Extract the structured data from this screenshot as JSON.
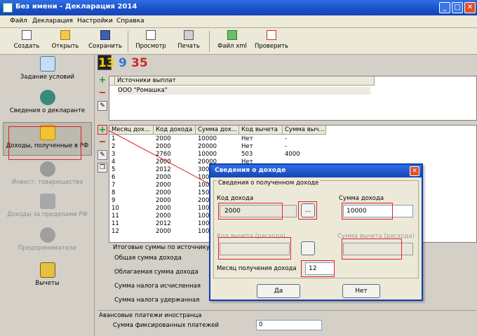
{
  "window": {
    "title": "Без имени - Декларация 2014"
  },
  "menu": [
    "Файл",
    "Декларация",
    "Настройки",
    "Справка"
  ],
  "toolbar": {
    "create": "Создать",
    "open": "Открыть",
    "save": "Сохранить",
    "preview": "Просмотр",
    "print": "Печать",
    "xml": "Файл xml",
    "check": "Проверить"
  },
  "leftnav": [
    {
      "label": "Задание условий",
      "enabled": true
    },
    {
      "label": "Сведения о декларанте",
      "enabled": true
    },
    {
      "label": "Доходы, полученные в РФ",
      "enabled": true,
      "selected": true
    },
    {
      "label": "Инвест. товарищества",
      "enabled": false
    },
    {
      "label": "Доходы за пределами РФ",
      "enabled": false
    },
    {
      "label": "Предприниматели",
      "enabled": false
    },
    {
      "label": "Вычеты",
      "enabled": true
    }
  ],
  "rate_tabs": [
    "13",
    "9",
    "35"
  ],
  "sources": {
    "header": "Источники выплат",
    "rows": [
      "ООО \"Ромашка\""
    ]
  },
  "income_table": {
    "headers": [
      "Месяц дох...",
      "Код дохода",
      "Сумма дох...",
      "Код вычета",
      "Сумма выч..."
    ],
    "rows": [
      [
        "1",
        "2000",
        "10000",
        "Нет",
        "-"
      ],
      [
        "2",
        "2000",
        "20000",
        "Нет",
        "-"
      ],
      [
        "3",
        "2760",
        "10000",
        "503",
        "4000"
      ],
      [
        "4",
        "2000",
        "20000",
        "Нет",
        ""
      ],
      [
        "5",
        "2012",
        "3000",
        "",
        ""
      ],
      [
        "6",
        "2000",
        "1000",
        "",
        ""
      ],
      [
        "7",
        "2000",
        "1000",
        "",
        ""
      ],
      [
        "8",
        "2000",
        "1500",
        "",
        ""
      ],
      [
        "9",
        "2000",
        "2000",
        "",
        ""
      ],
      [
        "10",
        "2000",
        "1000",
        "",
        ""
      ],
      [
        "11",
        "2000",
        "1000",
        "",
        ""
      ],
      [
        "11",
        "2012",
        "1000",
        "",
        ""
      ],
      [
        "12",
        "2000",
        "1000",
        "",
        ""
      ]
    ]
  },
  "totals": {
    "group_title": "Итоговые суммы по источнику",
    "total_income": "Общая сумма дохода",
    "taxable": "Облагаемая сумма дохода",
    "tax_calculated": "Сумма налога исчисленная",
    "tax_withheld": "Сумма налога удержанная"
  },
  "advance": {
    "group_title": "Авансовые платежи иностранца",
    "fixed_label": "Сумма фиксированных платежей",
    "fixed_value": "0"
  },
  "dialog": {
    "title": "Сведения о доходе",
    "group": "Сведения о полученном доходе",
    "income_code_label": "Код дохода",
    "income_code_value": "2000",
    "income_sum_label": "Сумма дохода",
    "income_sum_value": "10000",
    "deduction_code_label": "Код вычета (расхода)",
    "deduction_sum_label": "Сумма вычета (расхода)",
    "month_label": "Месяц получения дохода",
    "month_value": "12",
    "ok": "Да",
    "cancel": "Нет",
    "ellipsis": "..."
  },
  "colors": {
    "titlebar": "#1a4fc8",
    "highlight": "#e0202a",
    "accent_green": "#1c9a1c"
  }
}
